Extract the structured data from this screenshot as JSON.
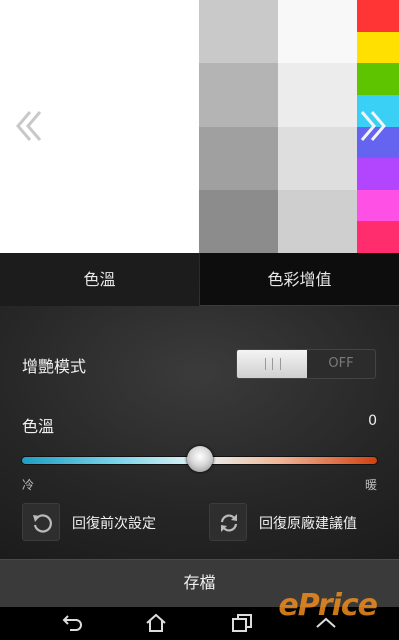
{
  "preview": {
    "grid": [
      [
        "#c9c9c9",
        "#f8f8f8"
      ],
      [
        "#b4b4b4",
        "#ececec"
      ],
      [
        "#a0a0a0",
        "#dedede"
      ],
      [
        "#8c8c8c",
        "#cfcfcf"
      ]
    ],
    "spectrum": [
      "#ff3434",
      "#ffe000",
      "#5ec400",
      "#3ad0f6",
      "#6464f0",
      "#b246ff",
      "#ff50e6",
      "#ff2d6e"
    ],
    "left_arrow_icon": "double-chevron-left",
    "right_arrow_icon": "double-chevron-right"
  },
  "tabs": [
    {
      "label": "色溫",
      "selected": true
    },
    {
      "label": "色彩增值",
      "selected": false
    }
  ],
  "vivid_mode": {
    "label": "增艷模式",
    "toggle_state_label": "OFF"
  },
  "color_temp": {
    "label": "色溫",
    "value": "0",
    "slider_fraction": 0.5,
    "min_label": "冷",
    "max_label": "暖"
  },
  "actions": {
    "restore_previous": {
      "label": "回復前次設定",
      "icon": "undo-icon"
    },
    "restore_defaults": {
      "label": "回復原廠建議值",
      "icon": "refresh-icon"
    }
  },
  "save_label": "存檔",
  "navbar": {
    "back_icon": "back-icon",
    "home_icon": "home-icon",
    "recents_icon": "recents-icon",
    "up_icon": "chevron-up-icon"
  },
  "watermark": "ePrice"
}
